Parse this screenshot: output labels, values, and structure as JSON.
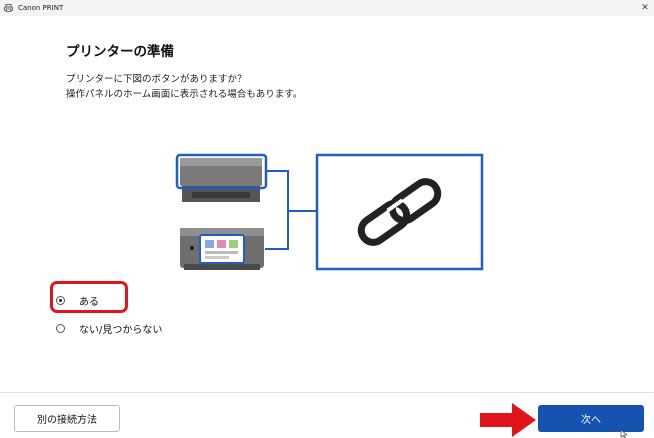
{
  "app": {
    "title": "Canon PRINT",
    "icon": "printer-icon"
  },
  "window_controls": {
    "close_glyph": "✕"
  },
  "page": {
    "heading": "プリンターの準備",
    "description_line1": "プリンターに下図のボタンがありますか？",
    "description_line2": "操作パネルのホーム画面に表示される場合もあります。"
  },
  "illustration": {
    "icon": "link-icon",
    "accent_color": "#1f5fbf"
  },
  "options": [
    {
      "label": "ある",
      "selected": true
    },
    {
      "label": "ない/見つからない",
      "selected": false
    }
  ],
  "footer": {
    "alt_button_label": "別の接続方法",
    "next_button_label": "次へ"
  },
  "annotation": {
    "highlight_color": "#e2141b"
  }
}
